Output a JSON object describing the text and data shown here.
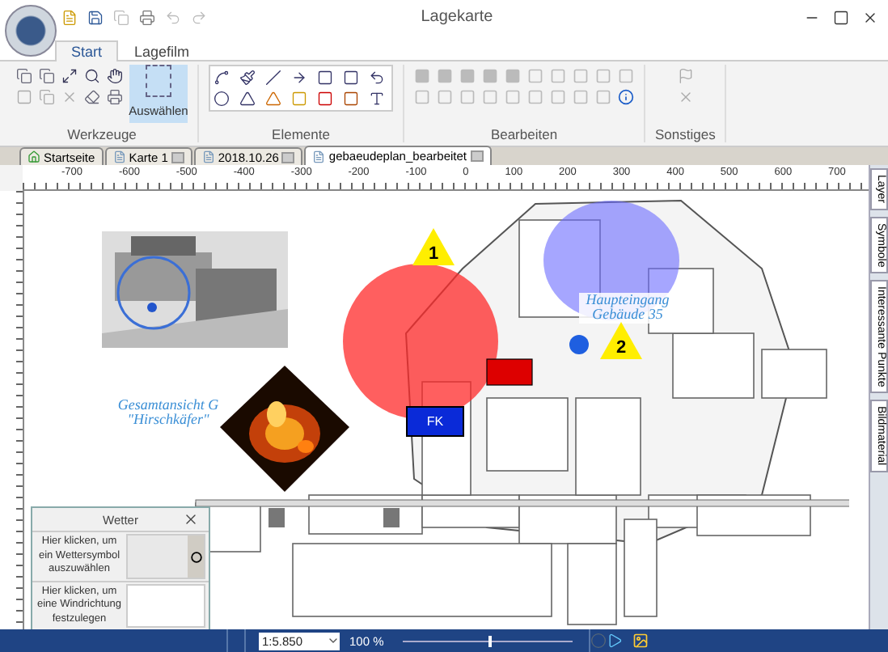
{
  "window": {
    "title": "Lagekarte"
  },
  "ribbon_tabs": [
    {
      "label": "Start",
      "selected": true
    },
    {
      "label": "Lagefilm",
      "selected": false
    }
  ],
  "ribbon_groups": [
    {
      "kind": "tools",
      "label": "Werkzeuge",
      "button": {
        "label": "Auswählen",
        "selected": true
      }
    },
    {
      "kind": "elements",
      "label": "Elemente"
    },
    {
      "kind": "edit",
      "label": "Bearbeiten"
    },
    {
      "kind": "misc",
      "label": "Sonstiges"
    }
  ],
  "document_tabs": [
    {
      "label": "Startseite",
      "selected": false,
      "kind": "home"
    },
    {
      "label": "Karte 1",
      "selected": false,
      "kind": "doc"
    },
    {
      "label": "2018.10.26",
      "selected": false,
      "kind": "doc"
    },
    {
      "label": "gebaeudeplan_bearbeitet",
      "selected": true,
      "kind": "doc"
    }
  ],
  "ruler": [
    "-700",
    "-600",
    "-500",
    "-400",
    "-300",
    "-200",
    "-100",
    "0",
    "100",
    "200",
    "300",
    "400",
    "500",
    "600",
    "700"
  ],
  "side_tabs": [
    {
      "label": "Layer"
    },
    {
      "label": "Symbole"
    },
    {
      "label": "Interessante Punkte"
    },
    {
      "label": "Bildmaterial"
    }
  ],
  "map": {
    "captions": [
      "Haupteingang\nGebäude 35",
      "Gesamtansicht G\n\"Hirschkäfer\""
    ],
    "markers": [
      "1",
      "2"
    ],
    "vehicle": "FK"
  },
  "weather_panel": {
    "title": "Wetter",
    "rows": [
      {
        "kind": "symbol",
        "label": "Hier klicken, um ein Wettersymbol auszuwählen"
      },
      {
        "kind": "wind",
        "label": "Hier klicken, um eine Windrichtung festzulegen"
      }
    ]
  },
  "status_bar": {
    "scale": "1:5.850",
    "zoom": "100 %",
    "level": 0.5
  }
}
